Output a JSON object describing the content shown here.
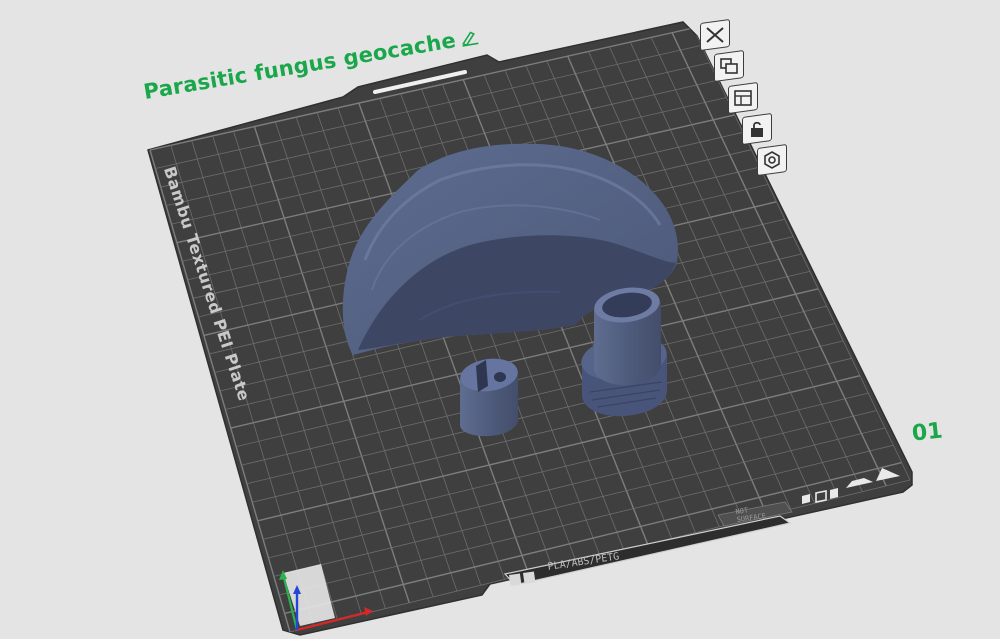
{
  "plate": {
    "name": "Parasitic fungus geocache",
    "index": "01",
    "bed_type": "Bambu Textured PEI Plate",
    "filament_strip": "PLA/ABS/PETG",
    "surface_sticker": "NOT\nSURFACE"
  },
  "tools": [
    {
      "name": "close-plate-button",
      "icon": "x-icon"
    },
    {
      "name": "arrange-button",
      "icon": "arrange-icon"
    },
    {
      "name": "orient-button",
      "icon": "orient-icon"
    },
    {
      "name": "lock-plate-button",
      "icon": "lock-icon"
    },
    {
      "name": "plate-settings-button",
      "icon": "gear-icon"
    }
  ],
  "colors": {
    "accent": "#1aa64a",
    "plate": "#3f3f3f",
    "grid": "#6d6d6d",
    "model": "#5b6a8c",
    "background": "#e3e4e3"
  }
}
